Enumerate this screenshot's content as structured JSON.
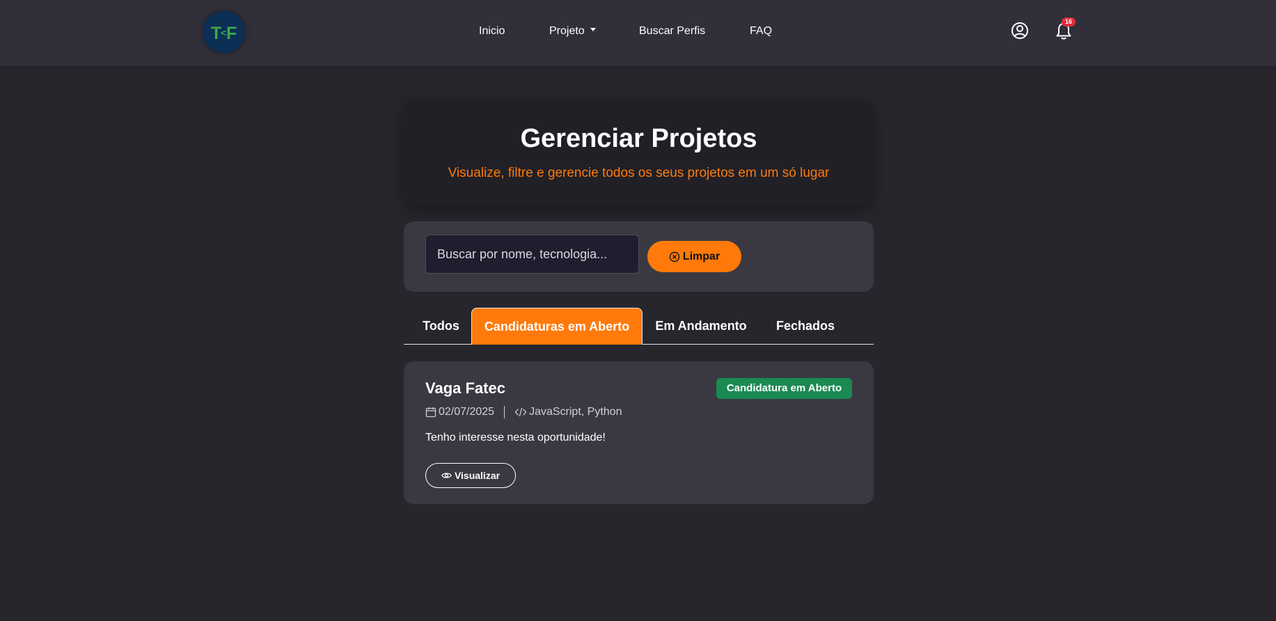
{
  "navbar": {
    "logo_text": "T<F",
    "links": [
      {
        "label": "Inicio"
      },
      {
        "label": "Projeto"
      },
      {
        "label": "Buscar Perfis"
      },
      {
        "label": "FAQ"
      }
    ],
    "notification_count": "16",
    "icons": {
      "profile": "user-circle-icon",
      "notifications": "bell-icon"
    }
  },
  "header": {
    "title": "Gerenciar Projetos",
    "subtitle": "Visualize, filtre e gerencie todos os seus projetos em um só lugar"
  },
  "search": {
    "placeholder": "Buscar por nome, tecnologia...",
    "value": "",
    "clear_label": "Limpar"
  },
  "tabs": [
    {
      "label": "Todos",
      "active": false
    },
    {
      "label": "Candidaturas em Aberto",
      "active": true
    },
    {
      "label": "Em Andamento",
      "active": false
    },
    {
      "label": "Fechados",
      "active": false
    }
  ],
  "projects": [
    {
      "title": "Vaga Fatec",
      "status": "Candidatura em Aberto",
      "date": "02/07/2025",
      "technologies": "JavaScript, Python",
      "description": "Tenho interesse nesta oportunidade!",
      "view_label": "Visualizar"
    }
  ],
  "colors": {
    "background": "#27262d",
    "navbar": "#302f3a",
    "accent": "#ff7a0a",
    "card": "#3a3942",
    "status_green": "#1a8a52",
    "badge_red": "#e02c3a"
  }
}
